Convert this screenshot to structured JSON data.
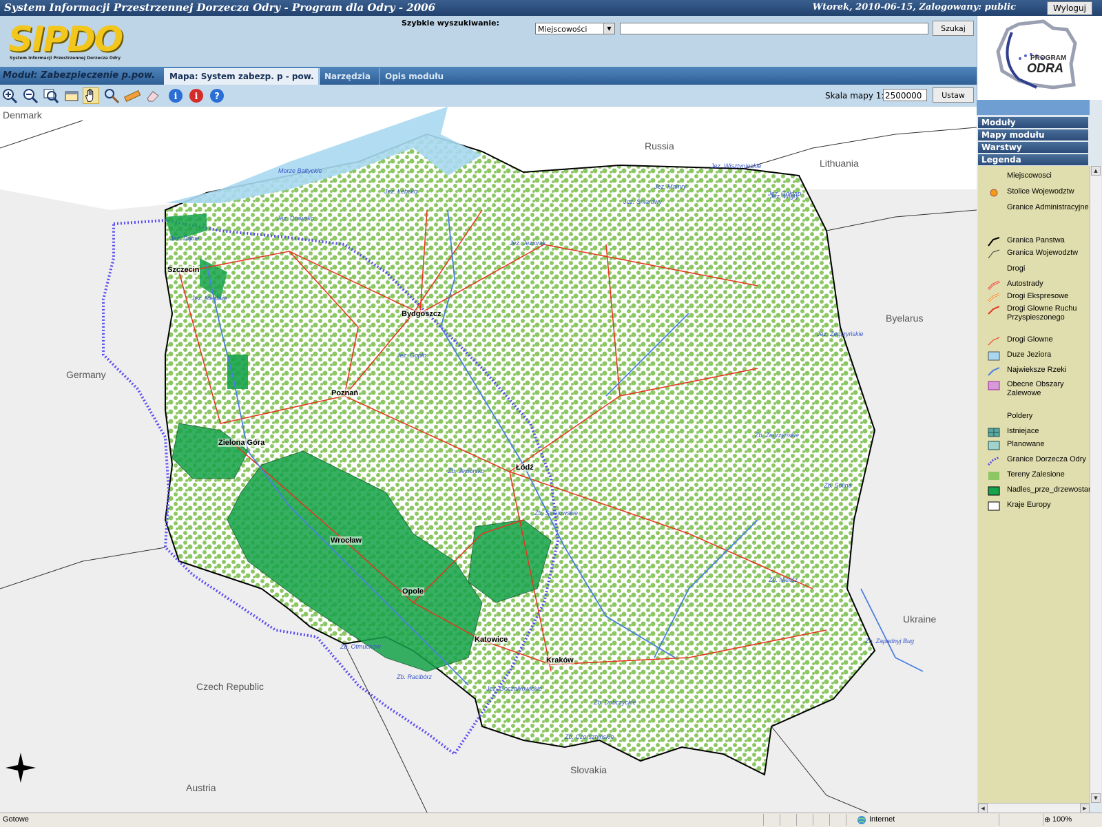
{
  "window": {
    "title": "System Informacji Przestrzennej Dorzecza Odry - Program dla Odry - 2006",
    "date_user": "Wtorek, 2010-06-15, Zalogowany: public",
    "logout_label": "Wyloguj"
  },
  "logo": {
    "word": "SIPDO",
    "subtitle": "System Informacji Przestrzennej Dorzecza Odry"
  },
  "program_logo": {
    "line1": "PROGRAM",
    "line2": "ODRA"
  },
  "search": {
    "label": "Szybkie wyszukiwanie:",
    "select_value": "Miejscowości",
    "input_value": "",
    "button_label": "Szukaj"
  },
  "module": {
    "label": "Moduł:  Zabezpieczenie p.pow.",
    "tabs": [
      {
        "label": "Mapa: System zabezp. p - pow.",
        "active": true
      },
      {
        "label": "Narzędzia",
        "active": false
      },
      {
        "label": "Opis modułu",
        "active": false
      }
    ]
  },
  "toolbar": {
    "tools": [
      "zoom-in-icon",
      "zoom-out-icon",
      "zoom-full-icon",
      "zoom-window-icon",
      "pan-hand-icon",
      "magnifier-icon",
      "ruler-icon",
      "eraser-icon",
      "info-icon",
      "info-red-icon",
      "help-icon"
    ],
    "selected_tool": "pan-hand-icon",
    "scale_label": "Skala mapy 1:",
    "scale_value": "2500000",
    "set_label": "Ustaw"
  },
  "map": {
    "countries": [
      "Denmark",
      "Russia",
      "Lithuania",
      "Byelarus",
      "Germany",
      "Ukraine",
      "Czech Republic",
      "Slovakia",
      "Austria"
    ],
    "cities": [
      "Szczecin",
      "Bydgoszcz",
      "Poznań",
      "Zielona Góra",
      "Łódź",
      "Wrocław",
      "Opole",
      "Katowice",
      "Kraków"
    ],
    "water_labels": [
      "Jez. Wisztynieckie",
      "Jez. Śniardwy",
      "Jez. Mamry",
      "Jez. Gołdap",
      "Jez. Jeziorak",
      "Jez. Drawsko",
      "Jez. Łebsko",
      "Morze Bałtyckie",
      "Jez. Dąbie",
      "Jez. Miedwie",
      "Jez. Gopło",
      "Jez. Zegrzyńskie",
      "Zb. Sulejowskie",
      "Zb. Jeziorsko",
      "Jez. Wigry",
      "Zb. Dobczyckie",
      "Zb. Czorsztyńskie",
      "Zb. Zegrzyńskie",
      "Zb. Solina",
      "Jez. Goczałkowickie",
      "Zb. Zapadnyj Bug",
      "Zb. Nielisz",
      "Zb. Otmuchów",
      "Zb. Racibórz"
    ]
  },
  "panel": {
    "sections": [
      "Moduły",
      "Mapy modułu",
      "Warstwy",
      "Legenda"
    ],
    "legend": [
      {
        "label": "Miejscowosci",
        "symbol": "none"
      },
      {
        "label": "Stolice Wojewodztw",
        "symbol": "orange-dot"
      },
      {
        "label": "Granice Administracyjne",
        "symbol": "none"
      },
      {
        "label": "Granica Panstwa",
        "symbol": "black-line"
      },
      {
        "label": "Granica Wojewodztw",
        "symbol": "thin-line"
      },
      {
        "label": "Drogi",
        "symbol": "none"
      },
      {
        "label": "Autostrady",
        "symbol": "red-double"
      },
      {
        "label": "Drogi Ekspresowe",
        "symbol": "orange-double"
      },
      {
        "label": "Drogi Glowne Ruchu Przyspieszonego",
        "symbol": "red-line"
      },
      {
        "label": "Drogi Glowne",
        "symbol": "thin-red"
      },
      {
        "label": "Duze Jeziora",
        "symbol": "lightblue-box"
      },
      {
        "label": "Najwieksze Rzeki",
        "symbol": "blue-line"
      },
      {
        "label": "Obecne Obszary Zalewowe",
        "symbol": "pink-box"
      },
      {
        "label": "Poldery",
        "symbol": "none"
      },
      {
        "label": "Istniejace",
        "symbol": "teal-hatch"
      },
      {
        "label": "Planowane",
        "symbol": "teal-dots"
      },
      {
        "label": "Granice Dorzecza Odry",
        "symbol": "purple-dotted"
      },
      {
        "label": "Tereny Zalesione",
        "symbol": "lightgreen-box"
      },
      {
        "label": "Nadles_prze_drzewostanow",
        "symbol": "green-box"
      },
      {
        "label": "Kraje Europy",
        "symbol": "white-box"
      }
    ]
  },
  "status": {
    "text": "Gotowe",
    "zone": "Internet",
    "zoom": "100%"
  },
  "colors": {
    "accent": "#2f5f95",
    "forest": "#8cc764",
    "forest_dark": "#16a34a",
    "river": "#4a7fe0",
    "road": "#e8331c",
    "basin": "#5a4bf0"
  }
}
